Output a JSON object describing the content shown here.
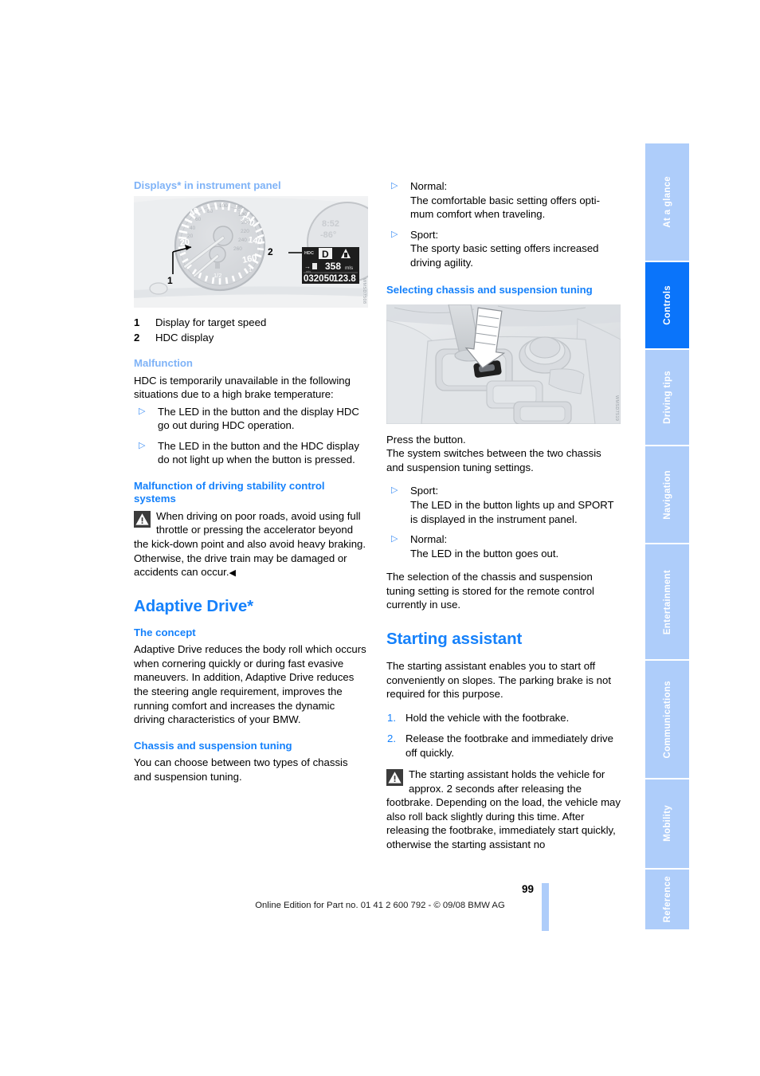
{
  "document": {
    "page_number": "99",
    "footer_note": "Online Edition for Part no. 01 41 2 600 792 - © 09/08 BMW AG"
  },
  "colors": {
    "heading_blue": "#1581fb",
    "heading_pale_blue": "#7fb3f7",
    "tab_inactive": "#aecdfa",
    "tab_active": "#0a74fa"
  },
  "side_tabs": [
    {
      "label": "At a glance",
      "active": false
    },
    {
      "label": "Controls",
      "active": true
    },
    {
      "label": "Driving tips",
      "active": false
    },
    {
      "label": "Navigation",
      "active": false
    },
    {
      "label": "Entertainment",
      "active": false
    },
    {
      "label": "Communications",
      "active": false
    },
    {
      "label": "Mobility",
      "active": false
    },
    {
      "label": "Reference",
      "active": false
    }
  ],
  "left_column": {
    "displays_heading": "Displays* in instrument panel",
    "cluster_figure": {
      "speed_ticks": [
        "20",
        "40",
        "120",
        "140",
        "160"
      ],
      "inner_ticks": [
        "20",
        "40",
        "60",
        "80",
        "100",
        "180",
        "200",
        "220",
        "240",
        "260"
      ],
      "fuel_label": "1/2",
      "clock": "8:52",
      "temperature": "-86°",
      "hdc_label": "HDC",
      "gear": "D",
      "range": "358",
      "range_unit": "mls",
      "odometer": "032050",
      "trip": "123.8",
      "trip_unit": "mls",
      "callout_1": "1",
      "callout_2": "2",
      "image_code": "WMSD7508"
    },
    "legend": [
      {
        "key": "1",
        "text": "Display for target speed"
      },
      {
        "key": "2",
        "text": "HDC display"
      }
    ],
    "malfunction_heading": "Malfunction",
    "malfunction_intro": "HDC is temporarily unavailable in the following situations due to a high brake temperature:",
    "malfunction_bullets": [
      "The LED in the button and the display HDC go out during HDC operation.",
      "The LED in the button and the HDC display do not light up when the button is pressed."
    ],
    "stability_heading": "Malfunction of driving stability control systems",
    "stability_warning": "When driving on poor roads, avoid using full throttle or pressing the accelerator beyond the kick-down point and also avoid heavy braking. Otherwise, the drive train may be damaged or accidents can occur.",
    "stability_warning_end": "◀",
    "adaptive_drive_title": "Adaptive Drive*",
    "concept_heading": "The concept",
    "concept_text": "Adaptive Drive reduces the body roll which occurs when cornering quickly or during fast evasive maneuvers. In addition, Adaptive Drive reduces the steering angle requirement, improves the running comfort and increases the dynamic driving characteristics of your BMW.",
    "chassis_heading": "Chassis and suspension tuning",
    "chassis_text": "You can choose between two types of chassis and suspension tuning."
  },
  "right_column": {
    "tuning_bullets": [
      "Normal:\nThe comfortable basic setting offers optimum comfort when traveling.",
      "Sport:\nThe sporty basic setting offers increased driving agility."
    ],
    "tuning_bullet_1_label": "Normal:",
    "tuning_bullet_1_body": "The comfortable basic setting offers opti-​mum comfort when traveling.",
    "tuning_bullet_2_label": "Sport:",
    "tuning_bullet_2_body": "The sporty basic setting offers increased driving agility.",
    "selecting_heading": "Selecting chassis and suspension tuning",
    "console_figure": {
      "image_code": "WMSD7519"
    },
    "press_button_text": "Press the button.\nThe system switches between the two chassis and suspension tuning settings.",
    "press_button_line1": "Press the button.",
    "press_button_line2": "The system switches between the two chassis and suspension tuning settings.",
    "result_bullet_1_label": "Sport:",
    "result_bullet_1_body": "The LED in the button lights up and SPORT is displayed in the instrument panel.",
    "result_bullet_2_label": "Normal:",
    "result_bullet_2_body": "The LED in the button goes out.",
    "stored_text": "The selection of the chassis and suspension tuning setting is stored for the remote control currently in use.",
    "starting_assistant_title": "Starting assistant",
    "starting_assistant_intro": "The starting assistant enables you to start off conveniently on slopes. The parking brake is not required for this purpose.",
    "steps": [
      {
        "num": "1.",
        "text": "Hold the vehicle with the footbrake."
      },
      {
        "num": "2.",
        "text": "Release the footbrake and immediately drive off quickly."
      }
    ],
    "starting_warning": "The starting assistant holds the vehicle for approx. 2 seconds after releasing the footbrake. Depending on the load, the vehicle may also roll back slightly during this time. After releasing the footbrake, immediately start quickly, otherwise the starting assistant no"
  }
}
